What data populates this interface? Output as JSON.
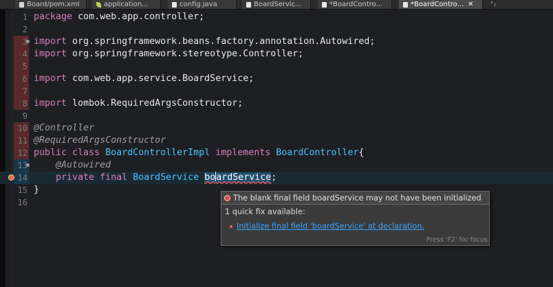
{
  "tabs": [
    {
      "label": "Board/pom.xml",
      "icon": "xml-file-icon"
    },
    {
      "label": "application...",
      "icon": "spring-leaf-icon"
    },
    {
      "label": "config.java",
      "icon": "java-file-icon"
    },
    {
      "label": "BoardServic...",
      "icon": "java-file-icon"
    },
    {
      "label": "*BoardContro...",
      "icon": "java-file-icon"
    },
    {
      "label": "*BoardContro...",
      "icon": "java-file-icon",
      "close": "✕"
    }
  ],
  "tab_extra": "⁺₁",
  "editor": {
    "line_numbers": [
      "1",
      "2",
      "3",
      "4",
      "5",
      "6",
      "7",
      "8",
      "9",
      "10",
      "11",
      "12",
      "13",
      "14",
      "15",
      "16"
    ],
    "code": {
      "l1_kw": "package",
      "l1_rest": " com.web.app.controller;",
      "l3_kw": "import",
      "l3_rest": " org.springframework.beans.factory.annotation.Autowired;",
      "l4_kw": "import",
      "l4_rest": " org.springframework.stereotype.Controller;",
      "l6_kw": "import",
      "l6_rest": " com.web.app.service.BoardService;",
      "l8_kw": "import",
      "l8_rest": " lombok.RequiredArgsConstructor;",
      "l10_ann": "@Controller",
      "l11_ann": "@RequiredArgsConstructor",
      "l12_kw": "public class",
      "l12_type": "BoardControllerImpl",
      "l12_kw2": "implements",
      "l12_iface": "BoardController",
      "l12_brace": "{",
      "l13_ann": "@Autowired",
      "l14_kw": "private final",
      "l14_type": "BoardService",
      "l14_var_a": "bo",
      "l14_var_b": "ardService",
      "l14_end": ";",
      "l15_brace": "}"
    }
  },
  "tooltip": {
    "message": "The blank final field boardService may not have been initialized",
    "quick_fix_label": "1 quick fix available:",
    "fix_link": "Initialize final field 'boardService' at declaration.",
    "footer": "Press 'F2' for focus"
  },
  "colors": {
    "keyword": "#d97dbf",
    "type": "#4fc1ff",
    "annotation": "#9e9e9e",
    "error": "#e36a3f",
    "link": "#3aa3ff"
  }
}
